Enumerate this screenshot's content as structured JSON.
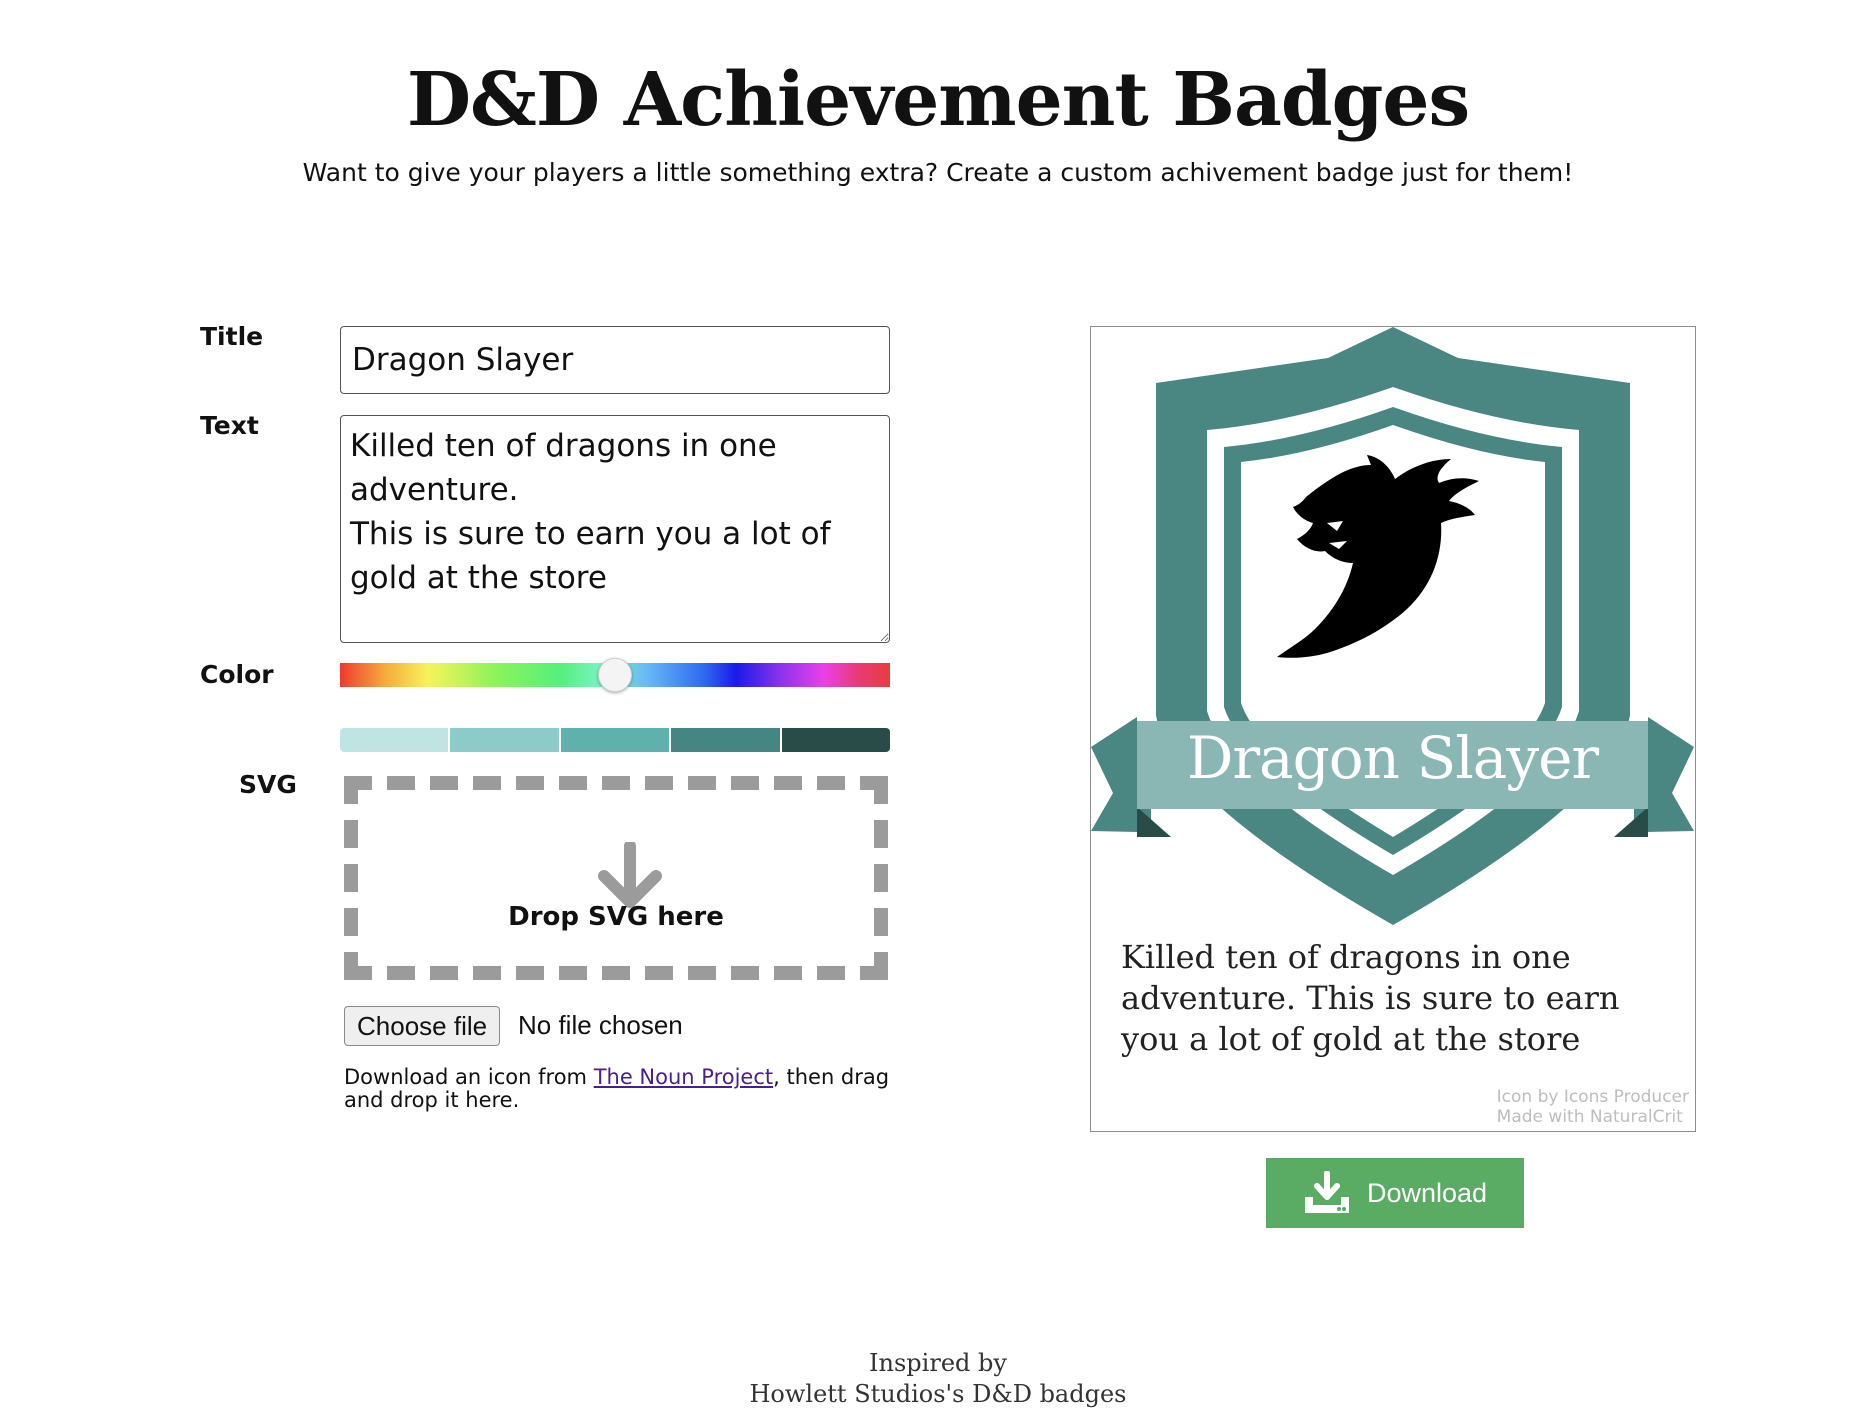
{
  "header": {
    "title": "D&D Achievement Badges",
    "subtitle": "Want to give your players a little something extra? Create a custom achivement badge just for them!"
  },
  "form": {
    "title_label": "Title",
    "title_value": "Dragon Slayer",
    "text_label": "Text",
    "text_value": "Killed ten of dragons in one adventure.\nThis is sure to earn you a lot of gold at the store",
    "color_label": "Color",
    "hue_value_percent": 50,
    "swatches": [
      "#bfe4e2",
      "#8ccbc8",
      "#5fb1ac",
      "#468682",
      "#2a4c49"
    ],
    "svg_label": "SVG",
    "drop_icon": "arrow-down-icon",
    "drop_text": "Drop SVG here",
    "file_button_label": "Choose file",
    "file_status": "No file chosen",
    "help_prefix": "Download an icon from ",
    "help_link": "The Noun Project",
    "help_suffix": ", then drag and drop it here."
  },
  "badge": {
    "icon": "dragon-icon",
    "shield_color": "#4a8682",
    "banner_color": "#8ab6b3",
    "title": "Dragon Slayer",
    "text": "Killed ten of dragons in one adventure. This is sure to earn you a lot of gold at the store",
    "credit_line1": "Icon by Icons Producer",
    "credit_line2": "Made with NaturalCrit"
  },
  "download": {
    "icon": "download-icon",
    "label": "Download",
    "color": "#5aac64"
  },
  "footer": {
    "line1": "Inspired by",
    "line2": "Howlett Studios's D&D badges"
  }
}
